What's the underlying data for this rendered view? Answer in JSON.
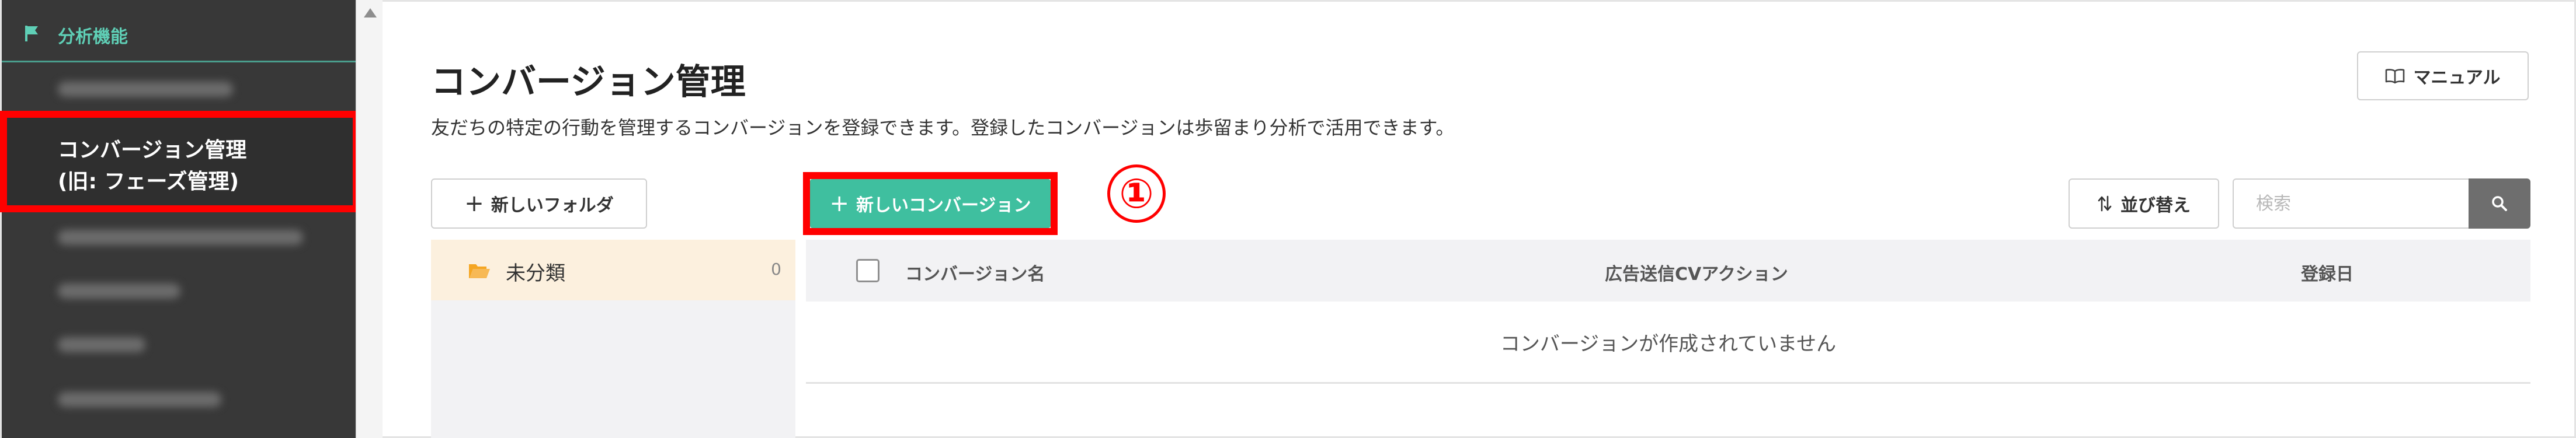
{
  "sidebar": {
    "section_label": "分析機能",
    "section_icon": "flag-icon",
    "active_item": {
      "line1": "コンバージョン管理",
      "line2": "(旧: フェーズ管理)"
    }
  },
  "header": {
    "title": "コンバージョン管理",
    "description": "友だちの特定の行動を管理するコンバージョンを登録できます。登録したコンバージョンは歩留まり分析で活用できます。",
    "manual_button": "マニュアル"
  },
  "toolbar": {
    "new_folder_button": "新しいフォルダ",
    "new_conversion_button": "新しいコンバージョン",
    "sort_button": "並び替え",
    "search_placeholder": "検索",
    "search_value": ""
  },
  "annotation": {
    "step_marker": "①",
    "highlight_color": "#ff0000"
  },
  "folders": [
    {
      "name": "未分類",
      "count": "0"
    }
  ],
  "table": {
    "columns": [
      "コンバージョン名",
      "広告送信CVアクション",
      "登録日"
    ],
    "empty_message": "コンバージョンが作成されていません"
  },
  "colors": {
    "accent": "#3fbf9f",
    "sidebar_bg": "#383838",
    "sidebar_accent": "#5fcfb6",
    "folder_selected_bg": "#fcf0de"
  }
}
